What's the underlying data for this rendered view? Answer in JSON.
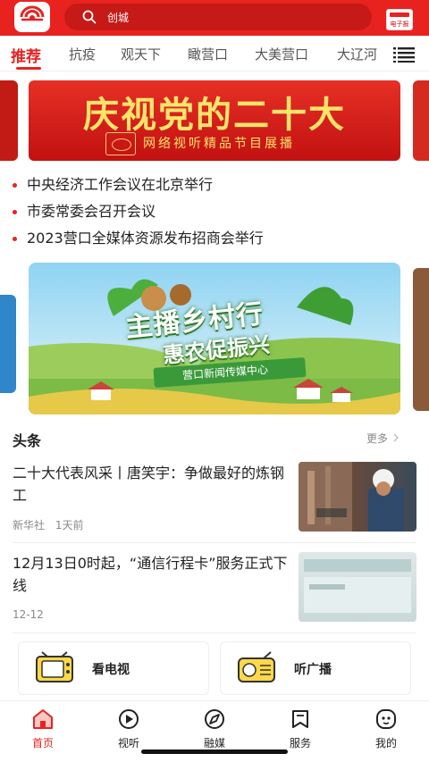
{
  "header": {
    "search_placeholder": "创城",
    "epaper_label": "电子报",
    "brand_color": "#e8231f"
  },
  "tabs": [
    {
      "label": "推荐",
      "active": true
    },
    {
      "label": "抗疫"
    },
    {
      "label": "观天下"
    },
    {
      "label": "瞰营口"
    },
    {
      "label": "大美营口"
    },
    {
      "label": "大辽河"
    }
  ],
  "banner_top": {
    "title": "庆视党的二十大",
    "subtitle": "网络视听精品节目展播"
  },
  "headlines": [
    "中央经济工作会议在北京举行",
    "市委常委会召开会议",
    "2023营口全媒体资源发布招商会举行"
  ],
  "banner_rural": {
    "title_line1": "主播乡村行",
    "title_line2": "惠农促振兴",
    "org": "营口新闻传媒中心"
  },
  "section": {
    "title": "头条",
    "more": "更多"
  },
  "articles": [
    {
      "title": "二十大代表风采丨唐笑宇：争做最好的炼钢工",
      "source": "新华社",
      "time": "1天前"
    },
    {
      "title": "12月13日0时起，“通信行程卡”服务正式下线",
      "time": "12-12"
    }
  ],
  "services": [
    {
      "label": "看电视",
      "icon": "tv-icon"
    },
    {
      "label": "听广播",
      "icon": "radio-icon"
    }
  ],
  "tabbar": [
    {
      "label": "首页",
      "icon": "home-icon",
      "active": true
    },
    {
      "label": "视听",
      "icon": "play-icon"
    },
    {
      "label": "融媒",
      "icon": "compass-icon"
    },
    {
      "label": "服务",
      "icon": "bookmark-icon"
    },
    {
      "label": "我的",
      "icon": "face-icon"
    }
  ]
}
